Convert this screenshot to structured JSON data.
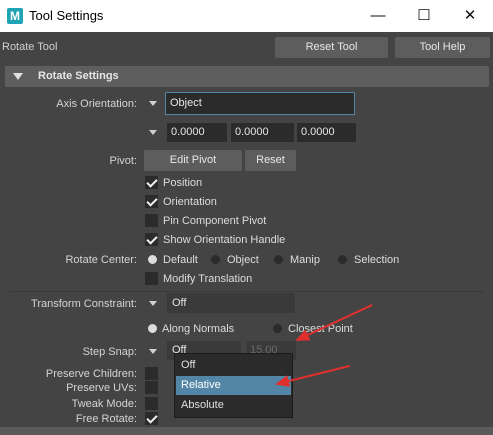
{
  "window": {
    "title": "Tool Settings",
    "app_icon_letter": "M",
    "minimize": "—",
    "maximize": "☐",
    "close": "✕"
  },
  "toolbar": {
    "tool_name": "Rotate Tool",
    "reset_tool": "Reset Tool",
    "tool_help": "Tool Help"
  },
  "section": {
    "title": "Rotate Settings"
  },
  "axis": {
    "label": "Axis Orientation:",
    "value": "Object",
    "vec": [
      "0.0000",
      "0.0000",
      "0.0000"
    ]
  },
  "pivot": {
    "label": "Pivot:",
    "edit_pivot": "Edit Pivot",
    "reset": "Reset"
  },
  "checkboxes": {
    "position": "Position",
    "orientation": "Orientation",
    "pin_component_pivot": "Pin Component Pivot",
    "show_orientation_handle": "Show Orientation Handle",
    "modify_translation": "Modify Translation"
  },
  "rotate_center": {
    "label": "Rotate Center:",
    "options": [
      "Default",
      "Object",
      "Manip",
      "Selection"
    ]
  },
  "transform_constraint": {
    "label": "Transform Constraint:",
    "value": "Off",
    "options": [
      "Along Normals",
      "Closest Point"
    ]
  },
  "step_snap": {
    "label": "Step Snap:",
    "value": "Off",
    "amount": "15.00"
  },
  "bottom_labels": {
    "preserve_children": "Preserve Children:",
    "preserve_uvs": "Preserve UVs:",
    "tweak_mode": "Tweak Mode:",
    "free_rotate": "Free Rotate:"
  },
  "popup": {
    "items": [
      "Off",
      "Relative",
      "Absolute"
    ],
    "highlighted": "Relative"
  },
  "colors": {
    "background": "#444444",
    "header": "#5e5e5e",
    "field": "#2b2b2b",
    "highlight": "#5285a6",
    "annotation_arrow": "#e0302d"
  }
}
